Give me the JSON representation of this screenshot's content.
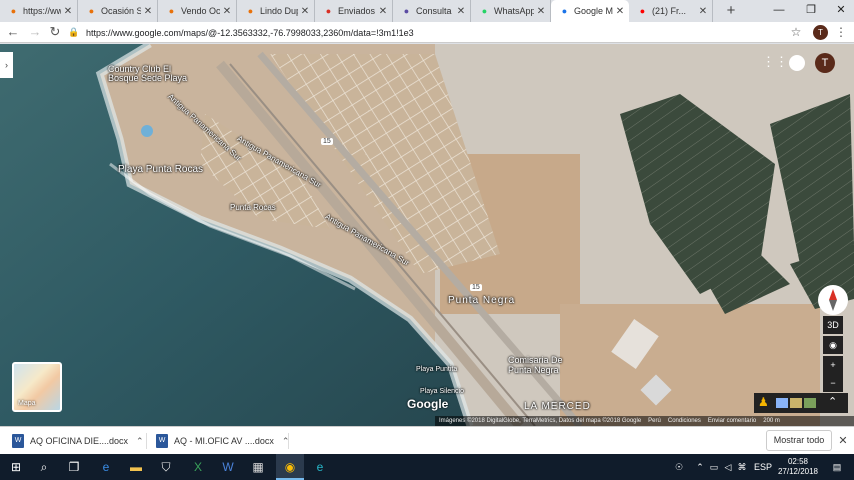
{
  "tabs": [
    {
      "title": "https://ww...",
      "favicon": "orange-pin-icon",
      "color": "#e8710a",
      "active": false
    },
    {
      "title": "Ocasión Sa...",
      "favicon": "orange-pin-icon",
      "color": "#e8710a",
      "active": false
    },
    {
      "title": "Vendo Oca...",
      "favicon": "orange-pin-icon",
      "color": "#e8710a",
      "active": false
    },
    {
      "title": "Lindo Dupl...",
      "favicon": "orange-pin-icon",
      "color": "#e8710a",
      "active": false
    },
    {
      "title": "Enviados -...",
      "favicon": "gmail-icon",
      "color": "#d93025",
      "active": false
    },
    {
      "title": "Consulta R...",
      "favicon": "diamond-icon",
      "color": "#5b4ba3",
      "active": false
    },
    {
      "title": "WhatsApp",
      "favicon": "whatsapp-icon",
      "color": "#25d366",
      "active": false
    },
    {
      "title": "Google Ma...",
      "favicon": "maps-icon",
      "color": "#1a73e8",
      "active": true
    },
    {
      "title": "(21) Fr...",
      "favicon": "youtube-icon",
      "color": "#ff0000",
      "active": false
    }
  ],
  "toolbar": {
    "url": "https://www.google.com/maps/@-12.3563332,-76.7998033,2360m/data=!3m1!1e3",
    "profile_initial": "T"
  },
  "map": {
    "labels": {
      "country_club": "Country Club El",
      "bosque": "Bosque Sede Playa",
      "playa_punta_rocas": "Playa Punta Rocas",
      "punta_rocas": "Punta Rocas",
      "antigua_1": "Antigua Panamericana Sur",
      "antigua_2": "Antigua Panamericana Sur",
      "antigua_3": "Antigua Panamericana Sur",
      "punta_negra": "Punta Negra",
      "comisaria_1": "Comisaria De",
      "comisaria_2": "Punta Negra",
      "playa_punta": "Playa Puntita",
      "playa_silencio": "Playa Silencio",
      "la_merced": "LA MERCED",
      "route_15": "15",
      "route_15b": "15"
    },
    "avatar_initial": "T",
    "minimap_label": "Mapa",
    "google_logo": "Google",
    "ctrl_3d": "3D",
    "zoom_in": "+",
    "zoom_out": "−",
    "footer": {
      "imagery": "Imágenes ©2018 DigitalGlobe, TerraMetrics, Datos del mapa ©2018 Google",
      "country": "Perú",
      "terms": "Condiciones",
      "feedback": "Enviar comentario",
      "scale": "200 m"
    }
  },
  "downloads": [
    {
      "name": "AQ OFICINA DIE....docx"
    },
    {
      "name": "AQ - MI.OFIC AV ....docx"
    }
  ],
  "downloads_bar": {
    "show_all": "Mostrar todo"
  },
  "taskbar": {
    "lang": "ESP",
    "time": "02:58",
    "date": "27/12/2018"
  }
}
